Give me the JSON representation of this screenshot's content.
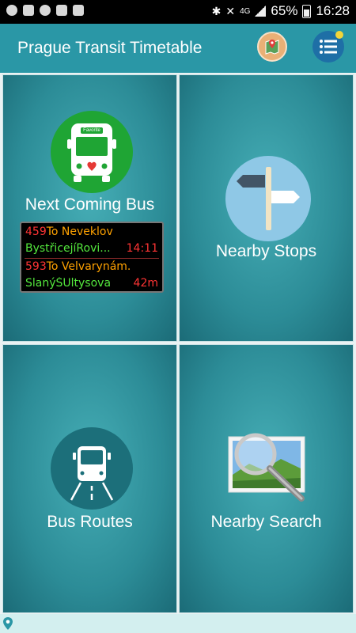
{
  "status_bar": {
    "battery": "65%",
    "time": "16:28",
    "network": "4G"
  },
  "app_bar": {
    "title": "Prague Transit Timetable"
  },
  "tiles": {
    "next_bus": {
      "label": "Next Coming Bus",
      "favorite_badge": "Favorite"
    },
    "nearby_stops": {
      "label": "Nearby Stops"
    },
    "bus_routes": {
      "label": "Bus Routes"
    },
    "nearby_search": {
      "label": "Nearby Search"
    }
  },
  "departures": [
    {
      "line": "459",
      "direction": "To Neveklov",
      "stop": "BystřicejíRovi...",
      "time": "14:11"
    },
    {
      "line": "593",
      "direction": "To Velvarynám.",
      "stop": "SlanýŠUltysova",
      "time": "42m"
    }
  ],
  "colors": {
    "app_bar": "#2a97a6",
    "tile": "#2c8c97",
    "bus_icon_green": "#1fa534",
    "line_red": "#ff3434",
    "direction_orange": "#ffa200",
    "stop_green": "#54e83d"
  }
}
